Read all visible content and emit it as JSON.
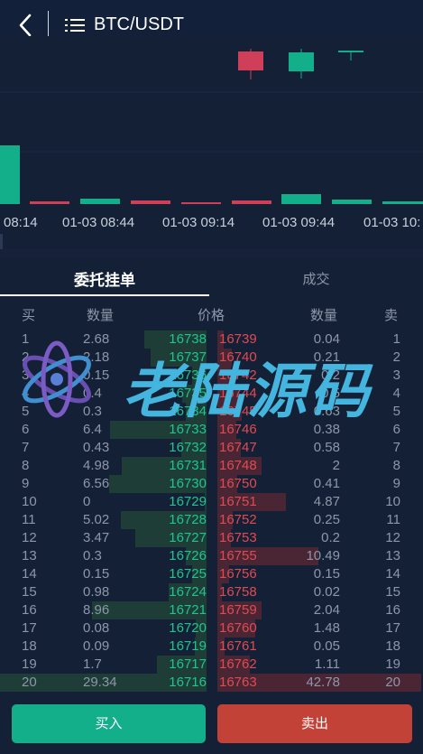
{
  "header": {
    "title": "BTC/USDT"
  },
  "chart": {
    "time_labels": [
      "08:14",
      "01-03 08:44",
      "01-03 09:14",
      "01-03 09:44",
      "01-03 10:"
    ],
    "up_color": "#13ae8a",
    "down_color": "#cf3f5a"
  },
  "tabs": {
    "active": "委托挂单",
    "inactive": "成交"
  },
  "columns": {
    "buy": "买",
    "bid_qty": "数量",
    "price": "价格",
    "ask_qty": "数量",
    "sell": "卖"
  },
  "orderbook": {
    "rows": [
      {
        "no": "1",
        "bid_qty": "2.68",
        "bid_price": "16738",
        "ask_price": "16739",
        "ask_qty": "0.04",
        "ask_no": "1"
      },
      {
        "no": "2",
        "bid_qty": "2.18",
        "bid_price": "16737",
        "ask_price": "16740",
        "ask_qty": "0.21",
        "ask_no": "2"
      },
      {
        "no": "3",
        "bid_qty": "0.15",
        "bid_price": "16736",
        "ask_price": "16742",
        "ask_qty": "0.2",
        "ask_no": "3"
      },
      {
        "no": "4",
        "bid_qty": "0.4",
        "bid_price": "16735",
        "ask_price": "16744",
        "ask_qty": "0.5",
        "ask_no": "4"
      },
      {
        "no": "5",
        "bid_qty": "0.3",
        "bid_price": "16734",
        "ask_price": "16745",
        "ask_qty": "0.63",
        "ask_no": "5"
      },
      {
        "no": "6",
        "bid_qty": "6.4",
        "bid_price": "16733",
        "ask_price": "16746",
        "ask_qty": "0.38",
        "ask_no": "6"
      },
      {
        "no": "7",
        "bid_qty": "0.43",
        "bid_price": "16732",
        "ask_price": "16747",
        "ask_qty": "0.58",
        "ask_no": "7"
      },
      {
        "no": "8",
        "bid_qty": "4.98",
        "bid_price": "16731",
        "ask_price": "16748",
        "ask_qty": "2",
        "ask_no": "8"
      },
      {
        "no": "9",
        "bid_qty": "6.56",
        "bid_price": "16730",
        "ask_price": "16750",
        "ask_qty": "0.41",
        "ask_no": "9"
      },
      {
        "no": "10",
        "bid_qty": "0",
        "bid_price": "16729",
        "ask_price": "16751",
        "ask_qty": "4.87",
        "ask_no": "10"
      },
      {
        "no": "11",
        "bid_qty": "5.02",
        "bid_price": "16728",
        "ask_price": "16752",
        "ask_qty": "0.25",
        "ask_no": "11"
      },
      {
        "no": "12",
        "bid_qty": "3.47",
        "bid_price": "16727",
        "ask_price": "16753",
        "ask_qty": "0.2",
        "ask_no": "12"
      },
      {
        "no": "13",
        "bid_qty": "0.3",
        "bid_price": "16726",
        "ask_price": "16755",
        "ask_qty": "10.49",
        "ask_no": "13"
      },
      {
        "no": "14",
        "bid_qty": "0.15",
        "bid_price": "16725",
        "ask_price": "16756",
        "ask_qty": "0.15",
        "ask_no": "14"
      },
      {
        "no": "15",
        "bid_qty": "0.98",
        "bid_price": "16724",
        "ask_price": "16758",
        "ask_qty": "0.02",
        "ask_no": "15"
      },
      {
        "no": "16",
        "bid_qty": "8.96",
        "bid_price": "16721",
        "ask_price": "16759",
        "ask_qty": "2.04",
        "ask_no": "16"
      },
      {
        "no": "17",
        "bid_qty": "0.08",
        "bid_price": "16720",
        "ask_price": "16760",
        "ask_qty": "1.48",
        "ask_no": "17"
      },
      {
        "no": "18",
        "bid_qty": "0.09",
        "bid_price": "16719",
        "ask_price": "16761",
        "ask_qty": "0.05",
        "ask_no": "18"
      },
      {
        "no": "19",
        "bid_qty": "1.7",
        "bid_price": "16717",
        "ask_price": "16762",
        "ask_qty": "1.11",
        "ask_no": "19"
      },
      {
        "no": "20",
        "bid_qty": "29.34",
        "bid_price": "16716",
        "ask_price": "16763",
        "ask_qty": "42.78",
        "ask_no": "20"
      }
    ]
  },
  "watermark": {
    "text": "老陆源码"
  },
  "actions": {
    "buy_label": "买入",
    "sell_label": "卖出"
  },
  "colors": {
    "bid": "#1ec58f",
    "ask": "#e04b52",
    "buy_button": "#13ae8a",
    "sell_button": "#c24238"
  }
}
